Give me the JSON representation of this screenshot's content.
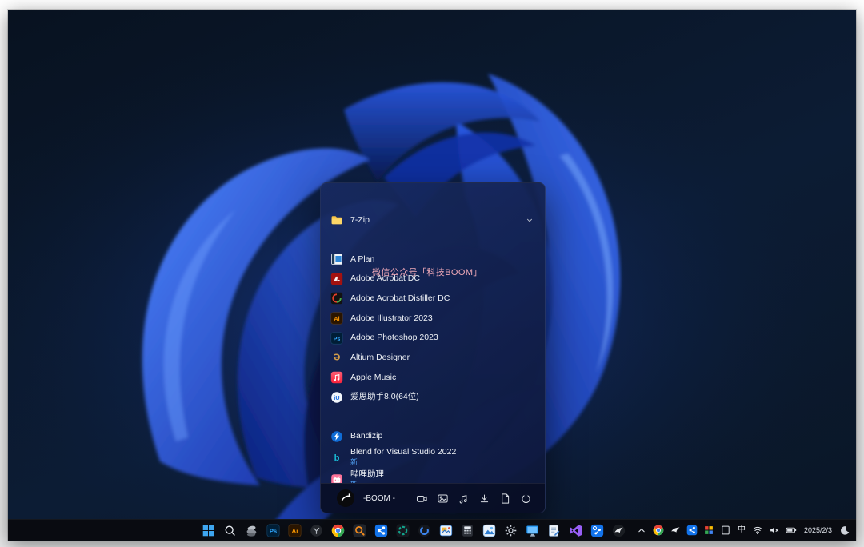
{
  "watermark": "微信公众号「科技BOOM」",
  "start_menu": {
    "sections": [
      {
        "items": [
          {
            "label": "7-Zip",
            "icon": "folder",
            "expandable": true
          }
        ]
      },
      {
        "items": [
          {
            "label": "A Plan",
            "icon": "a-plan"
          },
          {
            "label": "Adobe Acrobat DC",
            "icon": "acrobat"
          },
          {
            "label": "Adobe Acrobat Distiller DC",
            "icon": "distiller"
          },
          {
            "label": "Adobe Illustrator 2023",
            "icon": "ai"
          },
          {
            "label": "Adobe Photoshop 2023",
            "icon": "ps"
          },
          {
            "label": "Altium Designer",
            "icon": "altium"
          },
          {
            "label": "Apple Music",
            "icon": "apple-music"
          },
          {
            "label": "爱思助手8.0(64位)",
            "icon": "aisi"
          }
        ]
      },
      {
        "items": [
          {
            "label": "Bandizip",
            "icon": "bandizip"
          },
          {
            "label": "Blend for Visual Studio 2022",
            "icon": "blend",
            "badge": "新"
          },
          {
            "label": "哔哩助理",
            "icon": "bili",
            "badge": "新"
          }
        ]
      }
    ],
    "footer": {
      "user_name": "-BOOM -",
      "shortcuts": [
        {
          "name": "videos-folder-button",
          "icon": "f-video"
        },
        {
          "name": "pictures-folder-button",
          "icon": "f-image"
        },
        {
          "name": "music-folder-button",
          "icon": "f-music"
        },
        {
          "name": "downloads-folder-button",
          "icon": "f-download"
        },
        {
          "name": "documents-folder-button",
          "icon": "f-doc"
        },
        {
          "name": "power-button",
          "icon": "f-power"
        }
      ]
    }
  },
  "taskbar": {
    "pinned": [
      {
        "name": "start-button",
        "icon": "win"
      },
      {
        "name": "search-button",
        "icon": "search"
      },
      {
        "name": "pinned-app-stones",
        "icon": "stone"
      },
      {
        "name": "pinned-photoshop",
        "icon": "ps"
      },
      {
        "name": "pinned-illustrator",
        "icon": "ai"
      },
      {
        "name": "pinned-app-sphere",
        "icon": "sphere"
      },
      {
        "name": "pinned-chrome",
        "icon": "chrome"
      },
      {
        "name": "pinned-search-tool",
        "icon": "orange-search"
      },
      {
        "name": "pinned-share-app",
        "icon": "share-blue"
      },
      {
        "name": "pinned-app-teal-ring",
        "icon": "ring-teal"
      },
      {
        "name": "pinned-browser",
        "icon": "ring-blue"
      },
      {
        "name": "pinned-media-viewer",
        "icon": "viewer"
      },
      {
        "name": "pinned-calculator",
        "icon": "calculator"
      },
      {
        "name": "pinned-photos",
        "icon": "photos"
      },
      {
        "name": "pinned-settings",
        "icon": "settings"
      },
      {
        "name": "pinned-display",
        "icon": "monitor"
      },
      {
        "name": "pinned-notepad",
        "icon": "notepad"
      },
      {
        "name": "pinned-visual-studio",
        "icon": "vs"
      },
      {
        "name": "pinned-device-share",
        "icon": "gear-share"
      },
      {
        "name": "pinned-eagle-app",
        "icon": "eagle"
      }
    ],
    "tray": [
      {
        "name": "tray-hidden-icons-button",
        "icon": "chevron-up"
      },
      {
        "name": "tray-chrome",
        "icon": "chrome"
      },
      {
        "name": "tray-eagle-app",
        "icon": "bird"
      },
      {
        "name": "tray-share-app",
        "icon": "share-blue"
      },
      {
        "name": "tray-colorful-app",
        "icon": "grid-color"
      },
      {
        "name": "tray-window-app",
        "icon": "square-outline"
      },
      {
        "name": "tray-ime-indicator",
        "text": "中"
      },
      {
        "name": "tray-wifi",
        "icon": "wifi"
      },
      {
        "name": "tray-volume-muted",
        "icon": "vol-mute"
      },
      {
        "name": "tray-battery",
        "icon": "battery"
      },
      {
        "name": "tray-date",
        "text": "2025/2/3",
        "cls": "date"
      },
      {
        "name": "tray-notification-moon",
        "icon": "moon"
      }
    ]
  },
  "colors": {
    "accent_blue": "#3d86f0",
    "menu_bg": "#14265c",
    "taskbar_bg": "#0a0c12",
    "watermark_pink": "#efa9b8",
    "badge_blue": "#4f9ef0",
    "bloom_bright": "#3a6ef2",
    "bloom_deep": "#081a50"
  }
}
